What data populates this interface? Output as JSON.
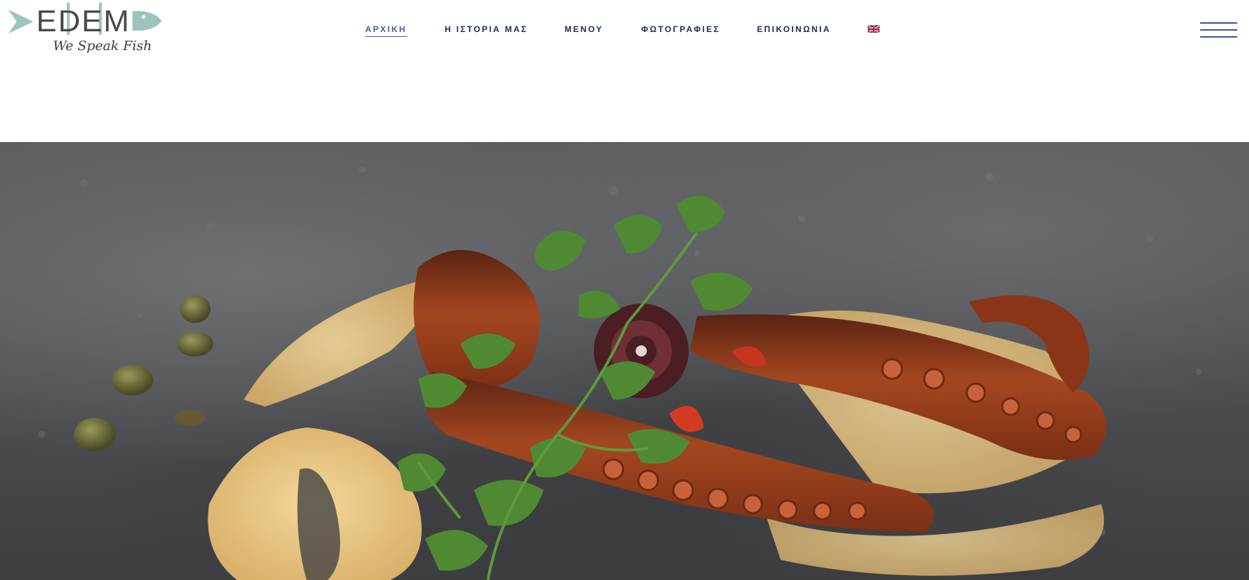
{
  "brand": {
    "name": "EDEM",
    "tagline": "We Speak Fish"
  },
  "nav": {
    "items": [
      {
        "label": "ΑΡΧΙΚΗ",
        "active": true
      },
      {
        "label": "Η ΙΣΤΟΡΙΑ ΜΑΣ",
        "active": false
      },
      {
        "label": "ΜΕΝΟΥ",
        "active": false
      },
      {
        "label": "ΦΩΤΟΓΡΑΦΙΕΣ",
        "active": false
      },
      {
        "label": "ΕΠΙΚΟΙΝΩΝΙΑ",
        "active": false
      }
    ],
    "language_icon": "uk-flag-icon",
    "menu_icon": "hamburger-menu-icon"
  },
  "colors": {
    "nav_text": "#1b2a55",
    "nav_active": "#4a5e96",
    "logo_fish": "#9cc4bf",
    "hero_slate": "#4b4c4f"
  },
  "hero": {
    "image": "grilled-octopus-dish"
  }
}
